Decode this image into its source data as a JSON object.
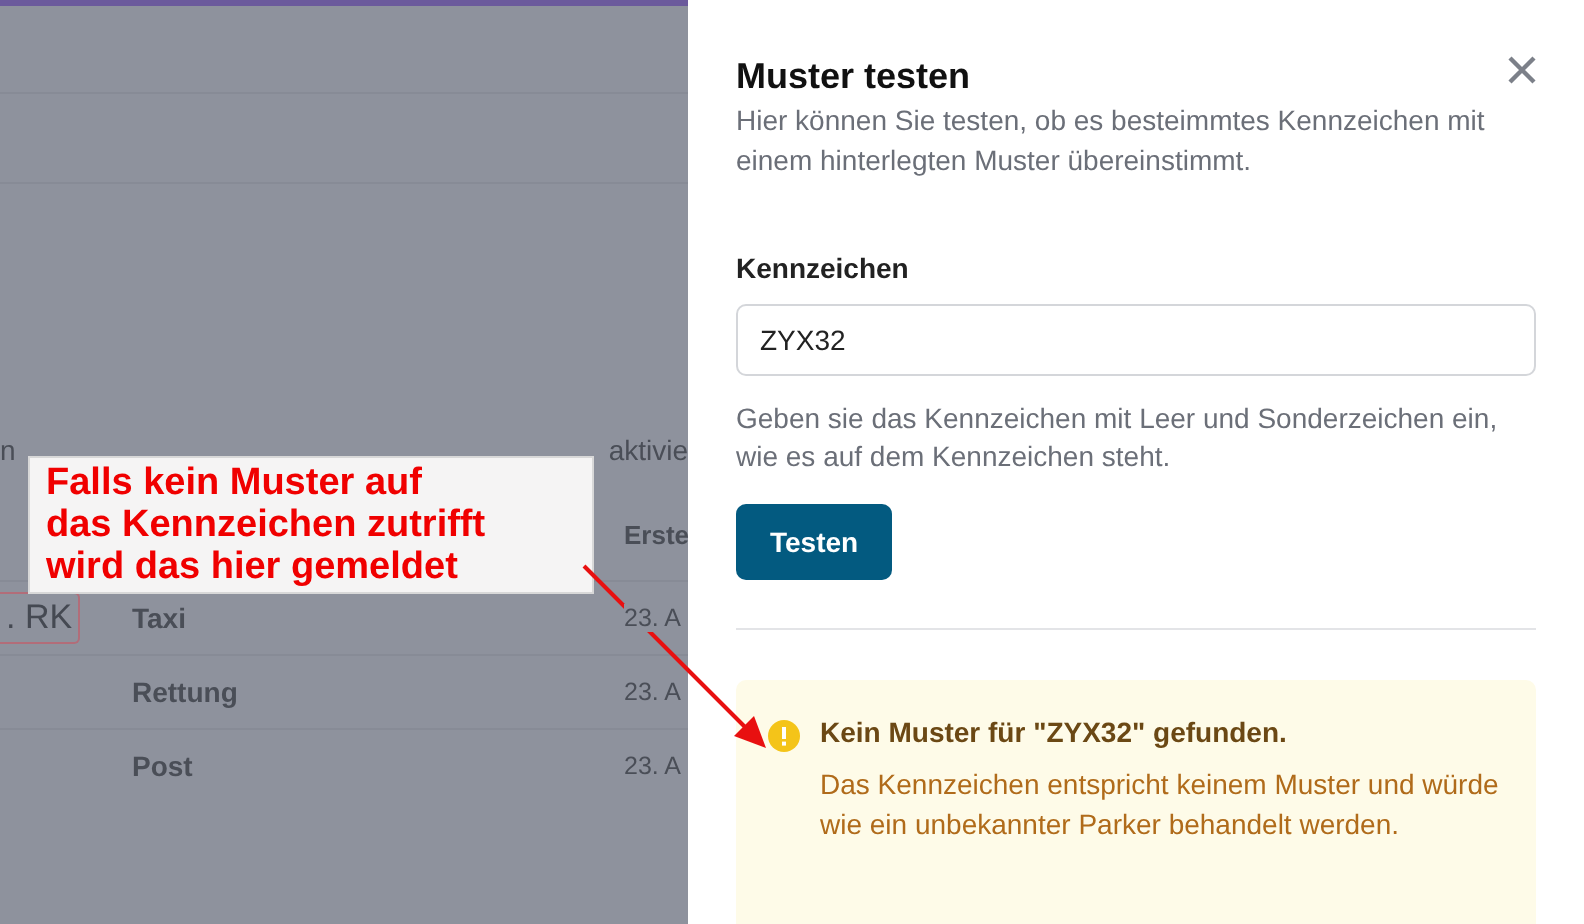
{
  "background": {
    "description_fragments": [
      "n",
      "aktivie"
    ],
    "table": {
      "columns": [
        "Erste"
      ],
      "rows": [
        {
          "badge": ". RK",
          "name": "Taxi",
          "date": "23. A"
        },
        {
          "badge": "",
          "name": "Rettung",
          "date": "23. A"
        },
        {
          "badge": "",
          "name": "Post",
          "date": "23. A"
        }
      ]
    }
  },
  "annotation": {
    "lines": [
      "Falls kein Muster auf",
      "das Kennzeichen zutrifft",
      "wird das hier gemeldet"
    ]
  },
  "drawer": {
    "title": "Muster testen",
    "description": "Hier können Sie testen, ob es besteimmtes Kennzeichen mit einem hinterlegten Muster übereinstimmt.",
    "field": {
      "label": "Kennzeichen",
      "value": "ZYX32",
      "help": "Geben sie das Kennzeichen mit Leer und Sonderzeichen ein, wie es auf dem Kennzeichen steht."
    },
    "button": "Testen",
    "alert": {
      "kind": "warning",
      "title": "Kein Muster für \"ZYX32\" gefunden.",
      "body": "Das Kennzeichen entspricht keinem Muster und würde wie ein unbekannter Parker behandelt werden."
    }
  }
}
